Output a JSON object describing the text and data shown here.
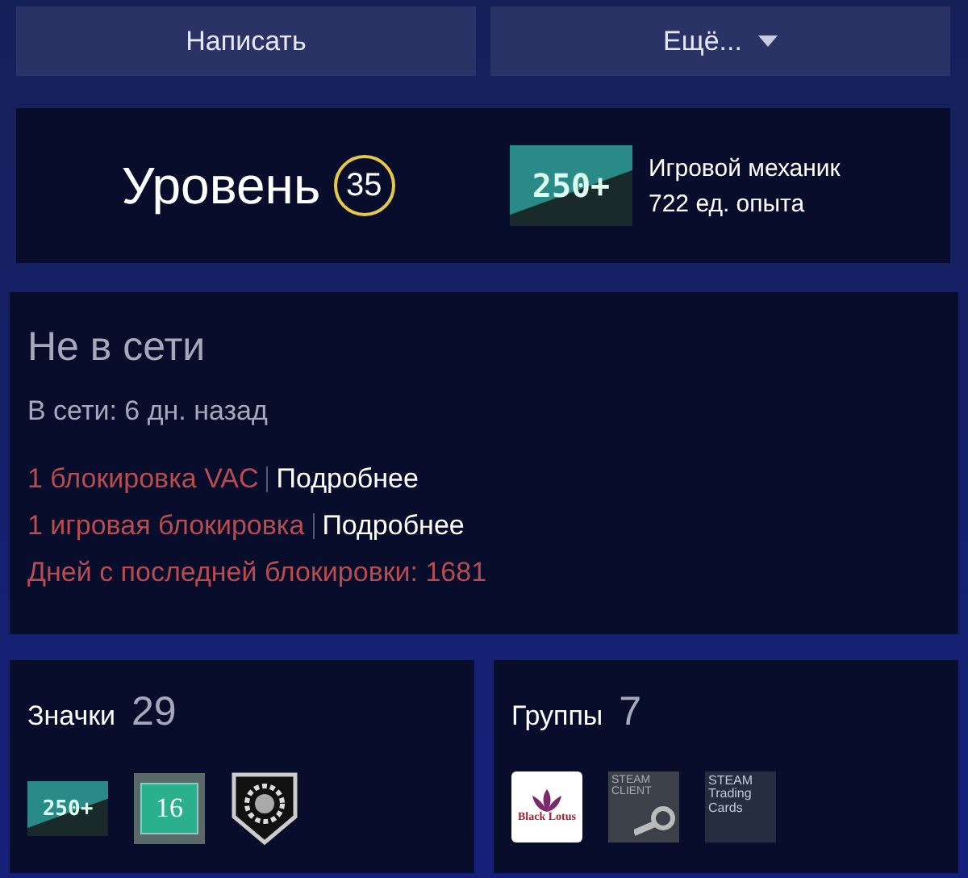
{
  "actions": [
    {
      "label": "Написать",
      "dropdown": false
    },
    {
      "label": "Ещё...",
      "dropdown": true
    }
  ],
  "level": {
    "label": "Уровень",
    "value": "35"
  },
  "featured_badge": {
    "icon_text": "250+",
    "name": "Игровой механик",
    "xp": "722 ед. опыта"
  },
  "status": {
    "title": "Не в сети",
    "last_online": "В сети: 6 дн. назад",
    "bans": [
      {
        "text": "1 блокировка VAC",
        "link": "Подробнее"
      },
      {
        "text": "1 игровая блокировка",
        "link": "Подробнее"
      }
    ],
    "days_since_ban": "Дней с последней блокировки: 1681"
  },
  "badges": {
    "title": "Значки",
    "count": "29",
    "items": [
      {
        "kind": "xp",
        "text": "250+"
      },
      {
        "kind": "years",
        "text": "16"
      },
      {
        "kind": "shield"
      }
    ]
  },
  "groups": {
    "title": "Группы",
    "count": "7",
    "items": [
      {
        "kind": "lotus",
        "text": "Black Lotus"
      },
      {
        "kind": "client",
        "text": "STEAM CLIENT"
      },
      {
        "kind": "cards",
        "text": "STEAM Trading Cards"
      }
    ]
  }
}
